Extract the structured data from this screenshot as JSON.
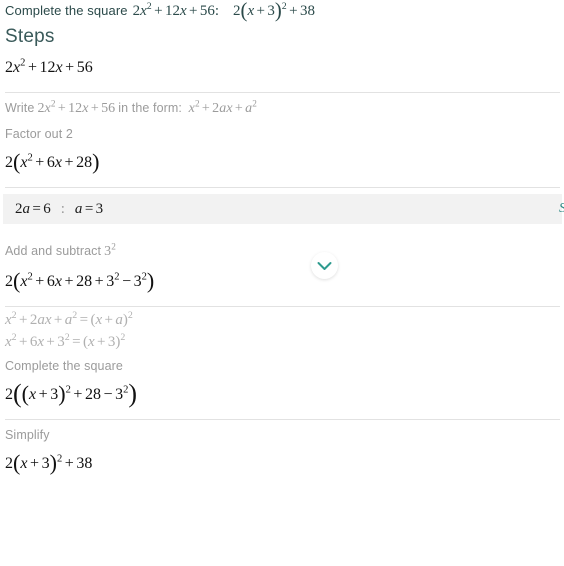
{
  "header": {
    "title_text": "Complete the square",
    "title_expression": "2x² + 12x + 56:",
    "title_result": "2(x + 3)² + 38",
    "steps_heading": "Steps"
  },
  "steps": [
    {
      "type": "expression",
      "name": "initial-expression",
      "text": "2x² + 12x + 56"
    },
    {
      "type": "divider"
    },
    {
      "type": "label",
      "name": "write-in-form-label",
      "prefix": "Write",
      "math_1": "2x² + 12x + 56",
      "middle": "in the form:",
      "math_2": "x² + 2ax + a²"
    },
    {
      "type": "label",
      "name": "factor-out-label",
      "text": "Factor out 2"
    },
    {
      "type": "expression",
      "name": "factored-expression",
      "text": "2(x² + 6x + 28)"
    },
    {
      "type": "divider"
    },
    {
      "type": "callout",
      "name": "a-value-callout",
      "left": "2a = 6",
      "colon": ":",
      "right": "a = 3",
      "link_label": "S"
    },
    {
      "type": "label",
      "name": "add-subtract-label",
      "text": "Add and subtract 3²"
    },
    {
      "type": "expression",
      "name": "add-subtract-expression",
      "text": "2(x² + 6x + 28 + 3² − 3²)"
    },
    {
      "type": "divider"
    },
    {
      "type": "formula",
      "name": "identity-general",
      "text": "x² + 2ax + a² = (x + a)²"
    },
    {
      "type": "formula",
      "name": "identity-applied",
      "text": "x² + 6x + 3² = (x + 3)²"
    },
    {
      "type": "label",
      "name": "complete-square-label",
      "text": "Complete the square"
    },
    {
      "type": "expression",
      "name": "completed-square-expression",
      "text": "2((x + 3)² + 28 − 3²)"
    },
    {
      "type": "divider"
    },
    {
      "type": "label",
      "name": "simplify-label",
      "text": "Simplify"
    },
    {
      "type": "expression",
      "name": "final-expression",
      "text": "2(x + 3)² + 38"
    }
  ],
  "controls": {
    "expand_chevron": "chevron-down-icon"
  },
  "colors": {
    "accent_teal": "#2e8b86",
    "title_slate": "#2b4a4a",
    "label_gray": "#9b9b9b",
    "formula_gray": "#b0b0b0",
    "callout_bg": "#f2f2f2",
    "divider": "#e2e2e2"
  }
}
